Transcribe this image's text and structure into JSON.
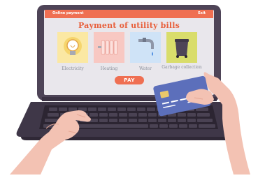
{
  "app": {
    "header_title": "Online payment",
    "exit_label": "Exit",
    "page_title": "Payment of utility bills"
  },
  "utilities": [
    {
      "label": "Electricity",
      "icon": "lightbulb-icon",
      "color": "#fbe8a3"
    },
    {
      "label": "Heating",
      "icon": "radiator-icon",
      "color": "#f8c8c2"
    },
    {
      "label": "Water",
      "icon": "faucet-icon",
      "color": "#cfe3f7"
    },
    {
      "label": "Garbage collection",
      "icon": "garbage-bin-icon",
      "color": "#d9dd6b"
    }
  ],
  "pay_label": "PAY",
  "colors": {
    "accent": "#ef6f52",
    "laptop_frame": "#4e4457",
    "screen_bg": "#e9e7ec",
    "card": "#5c6fbb",
    "skin": "#f3c2b3"
  }
}
